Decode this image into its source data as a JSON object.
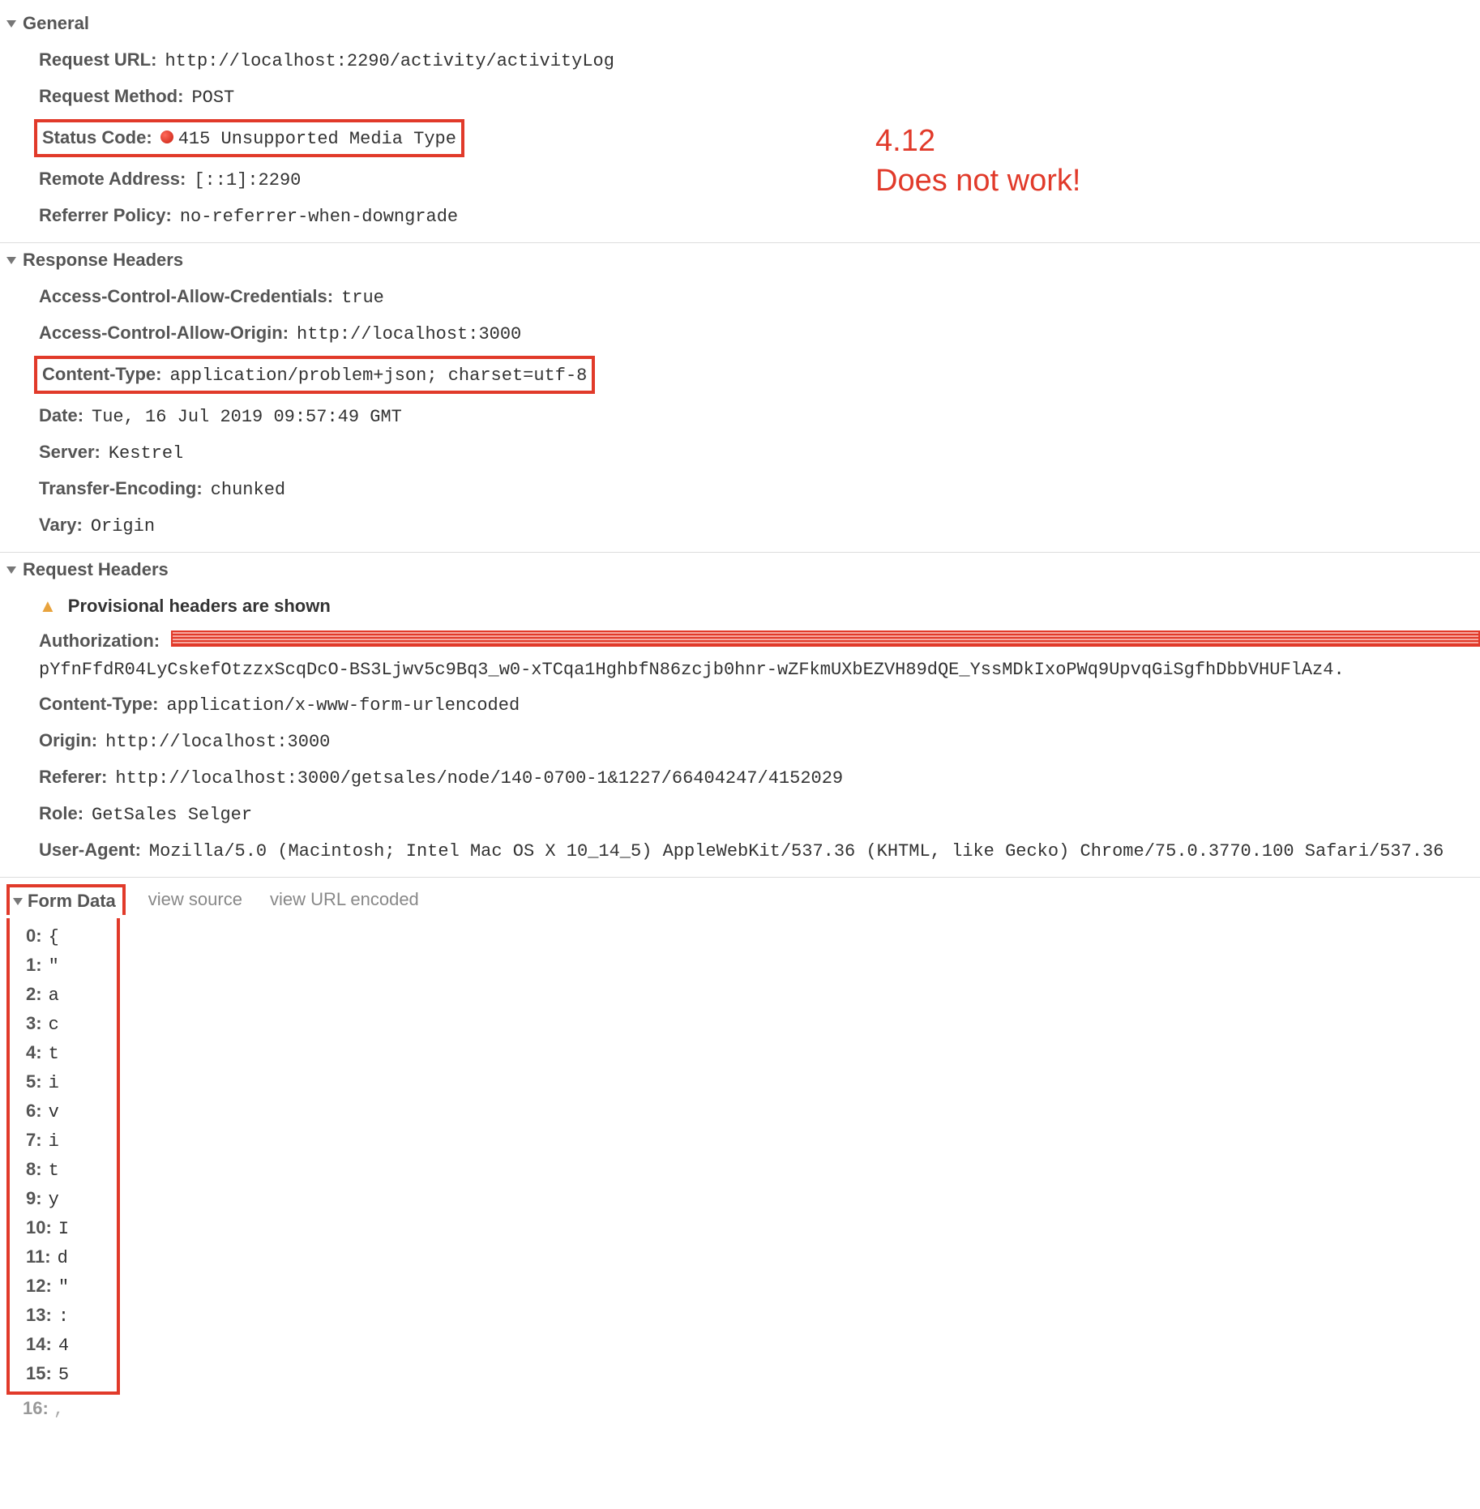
{
  "annotation": {
    "line1": "4.12",
    "line2": "Does not work!"
  },
  "sections": {
    "general": {
      "title": "General",
      "request_url": {
        "label": "Request URL",
        "value": "http://localhost:2290/activity/activityLog"
      },
      "request_method": {
        "label": "Request Method",
        "value": "POST"
      },
      "status_code": {
        "label": "Status Code",
        "value": "415 Unsupported Media Type"
      },
      "remote_address": {
        "label": "Remote Address",
        "value": "[::1]:2290"
      },
      "referrer_policy": {
        "label": "Referrer Policy",
        "value": "no-referrer-when-downgrade"
      }
    },
    "response_headers": {
      "title": "Response Headers",
      "ac_credentials": {
        "label": "Access-Control-Allow-Credentials",
        "value": "true"
      },
      "ac_origin": {
        "label": "Access-Control-Allow-Origin",
        "value": "http://localhost:3000"
      },
      "content_type": {
        "label": "Content-Type",
        "value": "application/problem+json; charset=utf-8"
      },
      "date": {
        "label": "Date",
        "value": "Tue, 16 Jul 2019 09:57:49 GMT"
      },
      "server": {
        "label": "Server",
        "value": "Kestrel"
      },
      "transfer_encoding": {
        "label": "Transfer-Encoding",
        "value": "chunked"
      },
      "vary": {
        "label": "Vary",
        "value": "Origin"
      }
    },
    "request_headers": {
      "title": "Request Headers",
      "provisional": "Provisional headers are shown",
      "authorization": {
        "label": "Authorization",
        "continuation": "pYfnFfdR04LyCskefOtzzxScqDcO-BS3Ljwv5c9Bq3_w0-xTCqa1HghbfN86zcjb0hnr-wZFkmUXbEZVH89dQE_YssMDkIxoPWq9UpvqGiSgfhDbbVHUFlAz4."
      },
      "content_type": {
        "label": "Content-Type",
        "value": "application/x-www-form-urlencoded"
      },
      "origin": {
        "label": "Origin",
        "value": "http://localhost:3000"
      },
      "referer": {
        "label": "Referer",
        "value": "http://localhost:3000/getsales/node/140-0700-1&1227/66404247/4152029"
      },
      "role": {
        "label": "Role",
        "value": "GetSales Selger"
      },
      "user_agent": {
        "label": "User-Agent",
        "value": "Mozilla/5.0 (Macintosh; Intel Mac OS X 10_14_5) AppleWebKit/537.36 (KHTML, like Gecko) Chrome/75.0.3770.100 Safari/537.36"
      }
    },
    "form_data": {
      "title": "Form Data",
      "view_source": "view source",
      "view_url_encoded": "view URL encoded",
      "items": [
        {
          "k": "0",
          "v": "{"
        },
        {
          "k": "1",
          "v": "\""
        },
        {
          "k": "2",
          "v": "a"
        },
        {
          "k": "3",
          "v": "c"
        },
        {
          "k": "4",
          "v": "t"
        },
        {
          "k": "5",
          "v": "i"
        },
        {
          "k": "6",
          "v": "v"
        },
        {
          "k": "7",
          "v": "i"
        },
        {
          "k": "8",
          "v": "t"
        },
        {
          "k": "9",
          "v": "y"
        },
        {
          "k": "10",
          "v": "I"
        },
        {
          "k": "11",
          "v": "d"
        },
        {
          "k": "12",
          "v": "\""
        },
        {
          "k": "13",
          "v": ":"
        },
        {
          "k": "14",
          "v": "4"
        },
        {
          "k": "15",
          "v": "5"
        }
      ],
      "trailing": {
        "k": "16",
        "v": ","
      }
    }
  }
}
